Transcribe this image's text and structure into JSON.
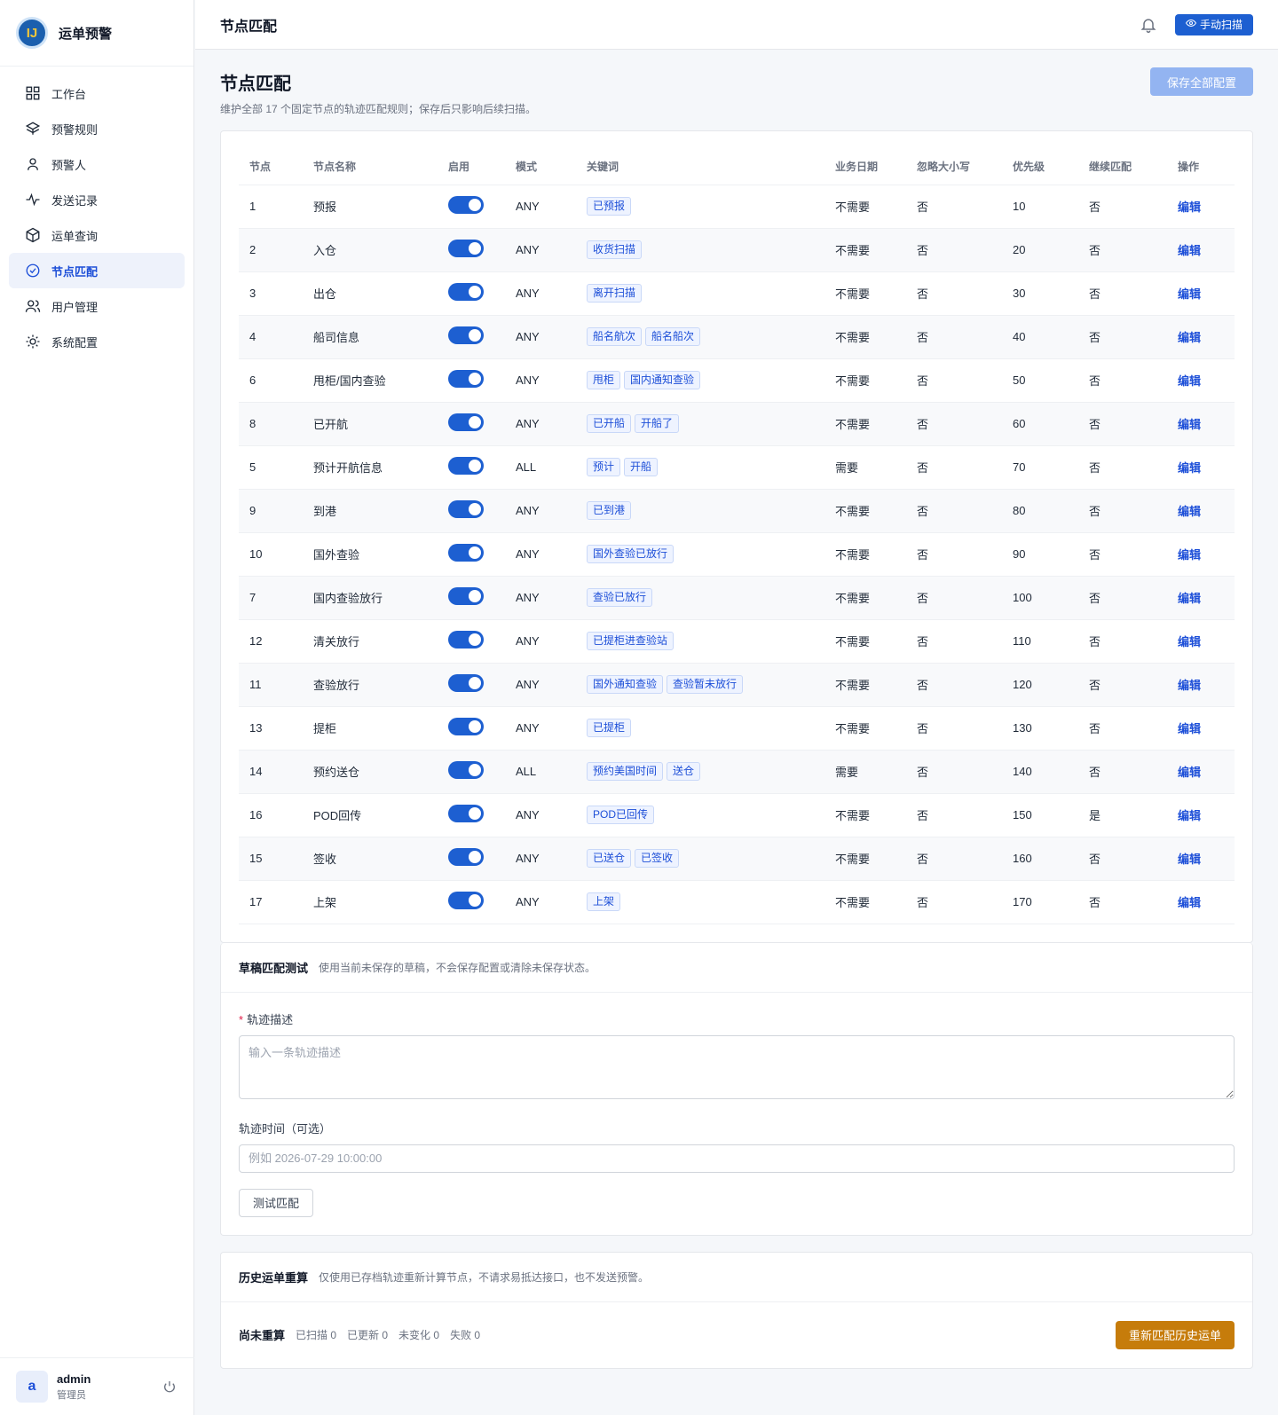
{
  "app": {
    "name": "运单预警",
    "logo_text": "IJ"
  },
  "sidebar": {
    "items": [
      {
        "label": "工作台",
        "icon": "grid-icon",
        "active": false
      },
      {
        "label": "预警规则",
        "icon": "layers-icon",
        "active": false
      },
      {
        "label": "预警人",
        "icon": "user-icon",
        "active": false
      },
      {
        "label": "发送记录",
        "icon": "activity-icon",
        "active": false
      },
      {
        "label": "运单查询",
        "icon": "package-icon",
        "active": false
      },
      {
        "label": "节点匹配",
        "icon": "check-circle-icon",
        "active": true
      },
      {
        "label": "用户管理",
        "icon": "users-icon",
        "active": false
      },
      {
        "label": "系统配置",
        "icon": "sun-icon",
        "active": false
      }
    ]
  },
  "user": {
    "avatar": "a",
    "name": "admin",
    "role": "管理员"
  },
  "topbar": {
    "title": "节点匹配",
    "scan_label": "手动扫描"
  },
  "page": {
    "title": "节点匹配",
    "desc": "维护全部 17 个固定节点的轨迹匹配规则；保存后只影响后续扫描。",
    "save_all": "保存全部配置"
  },
  "table": {
    "headers": [
      "节点",
      "节点名称",
      "启用",
      "模式",
      "关键词",
      "业务日期",
      "忽略大小写",
      "优先级",
      "继续匹配",
      "操作"
    ],
    "rows": [
      {
        "node": "1",
        "name": "预报",
        "enabled": true,
        "mode": "ANY",
        "keywords": [
          "已预报"
        ],
        "date": "不需要",
        "ignore_case": "否",
        "priority": "10",
        "cont": "否",
        "action": "编辑"
      },
      {
        "node": "2",
        "name": "入仓",
        "enabled": true,
        "mode": "ANY",
        "keywords": [
          "收货扫描"
        ],
        "date": "不需要",
        "ignore_case": "否",
        "priority": "20",
        "cont": "否",
        "action": "编辑"
      },
      {
        "node": "3",
        "name": "出仓",
        "enabled": true,
        "mode": "ANY",
        "keywords": [
          "离开扫描"
        ],
        "date": "不需要",
        "ignore_case": "否",
        "priority": "30",
        "cont": "否",
        "action": "编辑"
      },
      {
        "node": "4",
        "name": "船司信息",
        "enabled": true,
        "mode": "ANY",
        "keywords": [
          "船名航次",
          "船名船次"
        ],
        "date": "不需要",
        "ignore_case": "否",
        "priority": "40",
        "cont": "否",
        "action": "编辑"
      },
      {
        "node": "6",
        "name": "甩柜/国内查验",
        "enabled": true,
        "mode": "ANY",
        "keywords": [
          "甩柜",
          "国内通知查验"
        ],
        "date": "不需要",
        "ignore_case": "否",
        "priority": "50",
        "cont": "否",
        "action": "编辑"
      },
      {
        "node": "8",
        "name": "已开航",
        "enabled": true,
        "mode": "ANY",
        "keywords": [
          "已开船",
          "开船了"
        ],
        "date": "不需要",
        "ignore_case": "否",
        "priority": "60",
        "cont": "否",
        "action": "编辑"
      },
      {
        "node": "5",
        "name": "预计开航信息",
        "enabled": true,
        "mode": "ALL",
        "keywords": [
          "预计",
          "开船"
        ],
        "date": "需要",
        "ignore_case": "否",
        "priority": "70",
        "cont": "否",
        "action": "编辑"
      },
      {
        "node": "9",
        "name": "到港",
        "enabled": true,
        "mode": "ANY",
        "keywords": [
          "已到港"
        ],
        "date": "不需要",
        "ignore_case": "否",
        "priority": "80",
        "cont": "否",
        "action": "编辑"
      },
      {
        "node": "10",
        "name": "国外查验",
        "enabled": true,
        "mode": "ANY",
        "keywords": [
          "国外查验已放行"
        ],
        "date": "不需要",
        "ignore_case": "否",
        "priority": "90",
        "cont": "否",
        "action": "编辑"
      },
      {
        "node": "7",
        "name": "国内查验放行",
        "enabled": true,
        "mode": "ANY",
        "keywords": [
          "查验已放行"
        ],
        "date": "不需要",
        "ignore_case": "否",
        "priority": "100",
        "cont": "否",
        "action": "编辑"
      },
      {
        "node": "12",
        "name": "清关放行",
        "enabled": true,
        "mode": "ANY",
        "keywords": [
          "已提柜进查验站"
        ],
        "date": "不需要",
        "ignore_case": "否",
        "priority": "110",
        "cont": "否",
        "action": "编辑"
      },
      {
        "node": "11",
        "name": "查验放行",
        "enabled": true,
        "mode": "ANY",
        "keywords": [
          "国外通知查验",
          "查验暂未放行"
        ],
        "date": "不需要",
        "ignore_case": "否",
        "priority": "120",
        "cont": "否",
        "action": "编辑"
      },
      {
        "node": "13",
        "name": "提柜",
        "enabled": true,
        "mode": "ANY",
        "keywords": [
          "已提柜"
        ],
        "date": "不需要",
        "ignore_case": "否",
        "priority": "130",
        "cont": "否",
        "action": "编辑"
      },
      {
        "node": "14",
        "name": "预约送仓",
        "enabled": true,
        "mode": "ALL",
        "keywords": [
          "预约美国时间",
          "送仓"
        ],
        "date": "需要",
        "ignore_case": "否",
        "priority": "140",
        "cont": "否",
        "action": "编辑"
      },
      {
        "node": "16",
        "name": "POD回传",
        "enabled": true,
        "mode": "ANY",
        "keywords": [
          "POD已回传"
        ],
        "date": "不需要",
        "ignore_case": "否",
        "priority": "150",
        "cont": "是",
        "action": "编辑"
      },
      {
        "node": "15",
        "name": "签收",
        "enabled": true,
        "mode": "ANY",
        "keywords": [
          "已送仓",
          "已签收"
        ],
        "date": "不需要",
        "ignore_case": "否",
        "priority": "160",
        "cont": "否",
        "action": "编辑"
      },
      {
        "node": "17",
        "name": "上架",
        "enabled": true,
        "mode": "ANY",
        "keywords": [
          "上架"
        ],
        "date": "不需要",
        "ignore_case": "否",
        "priority": "170",
        "cont": "否",
        "action": "编辑"
      }
    ]
  },
  "draft_test": {
    "title": "草稿匹配测试",
    "desc": "使用当前未保存的草稿，不会保存配置或清除未保存状态。",
    "required_mark": "*",
    "track_label": "轨迹描述",
    "track_placeholder": "输入一条轨迹描述",
    "time_label": "轨迹时间（可选）",
    "time_placeholder": "例如 2026-07-29 10:00:00",
    "test_button": "测试匹配"
  },
  "recalc": {
    "title": "历史运单重算",
    "desc": "仅使用已存档轨迹重新计算节点，不请求易抵达接口，也不发送预警。",
    "status": "尚未重算",
    "stats": [
      "已扫描 0",
      "已更新 0",
      "未变化 0",
      "失败 0"
    ],
    "button": "重新匹配历史运单"
  },
  "colors": {
    "primary": "#1d5fd1",
    "accent": "#c67c0b",
    "save_disabled": "#93b4f1"
  }
}
